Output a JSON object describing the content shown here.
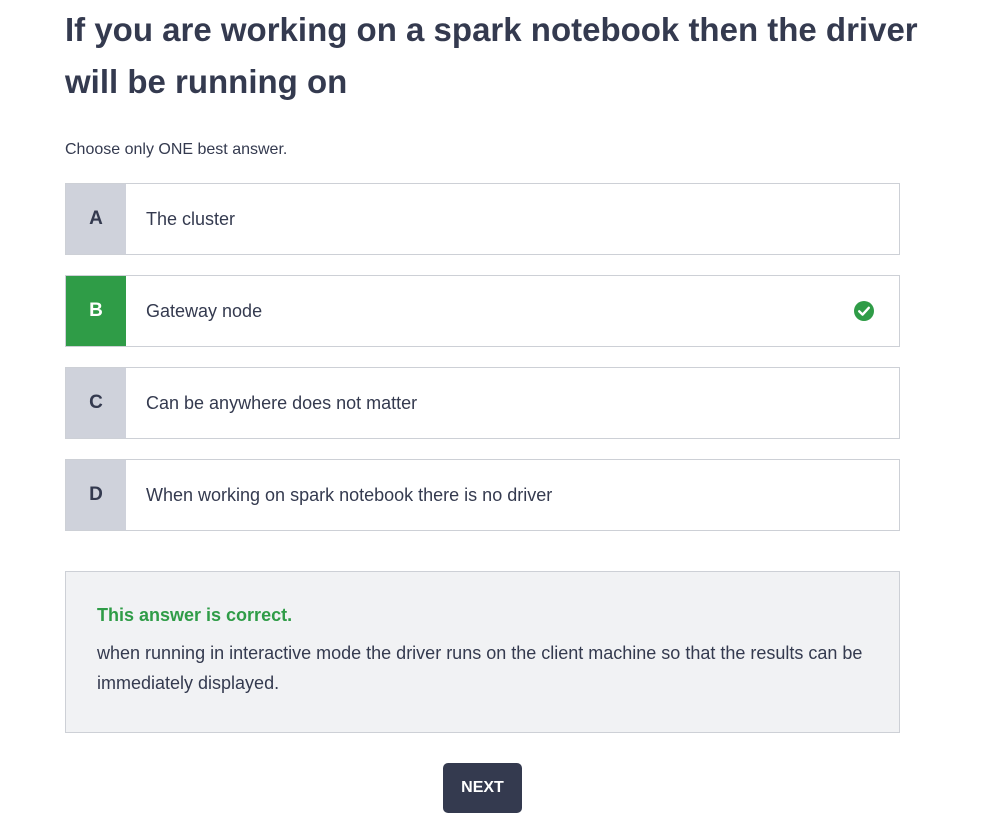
{
  "question": {
    "title": "If you are working on a spark notebook then the driver will be running on",
    "instruction": "Choose only ONE best answer."
  },
  "options": [
    {
      "letter": "A",
      "text": "The cluster"
    },
    {
      "letter": "B",
      "text": "Gateway node"
    },
    {
      "letter": "C",
      "text": "Can be anywhere does not matter"
    },
    {
      "letter": "D",
      "text": "When working on spark notebook there is no driver"
    }
  ],
  "selected_correct_option": "B",
  "feedback": {
    "status": "This answer is correct.",
    "explanation": "when running in interactive mode the driver runs on the client machine so that the results can be immediately displayed."
  },
  "actions": {
    "next_label": "NEXT"
  },
  "colors": {
    "correct": "#2f9c47",
    "text": "#343a4f",
    "letter_bg": "#cfd2db",
    "button_bg": "#343a4f"
  },
  "icons": {
    "correct_marker": "check-circle-icon"
  }
}
